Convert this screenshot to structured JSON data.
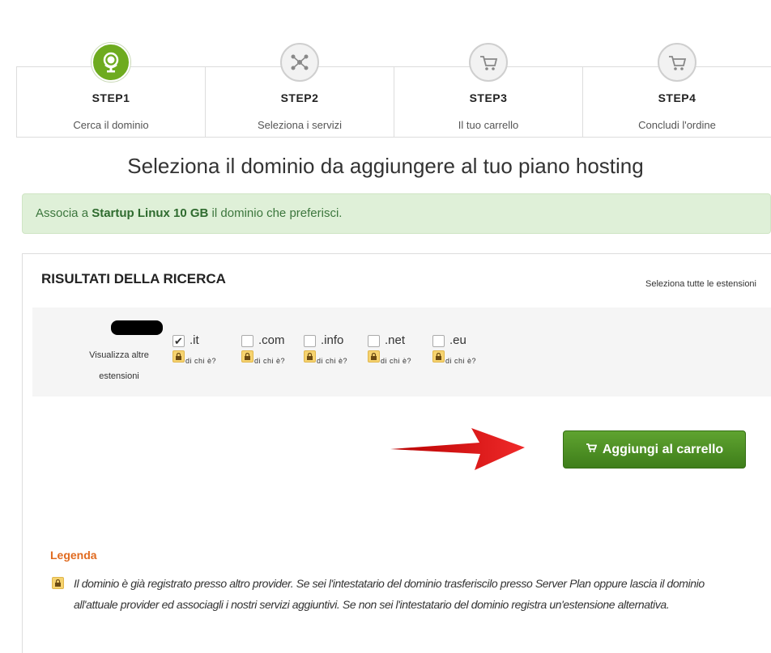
{
  "steps": [
    {
      "title": "STEP1",
      "subtitle": "Cerca il dominio",
      "icon": "globe-icon",
      "active": true
    },
    {
      "title": "STEP2",
      "subtitle": "Seleziona i servizi",
      "icon": "network-icon",
      "active": false
    },
    {
      "title": "STEP3",
      "subtitle": "Il tuo carrello",
      "icon": "cart-icon",
      "active": false
    },
    {
      "title": "STEP4",
      "subtitle": "Concludi l'ordine",
      "icon": "cart-icon",
      "active": false
    }
  ],
  "page_title": "Seleziona il dominio da aggiungere al tuo piano hosting",
  "alert": {
    "prefix": "Associa a ",
    "product": "Startup Linux 10 GB",
    "suffix": " il dominio che preferisci."
  },
  "results": {
    "title": "RISULTATI DELLA RICERCA",
    "select_all": "Seleziona tutte le estensioni",
    "more_label_1": "Visualizza altre",
    "more_label_2": "estensioni",
    "extensions": [
      {
        "name": ".it",
        "checked": true,
        "whois": "di chi è?"
      },
      {
        "name": ".com",
        "checked": false,
        "whois": "di chi è?"
      },
      {
        "name": ".info",
        "checked": false,
        "whois": "di chi è?"
      },
      {
        "name": ".net",
        "checked": false,
        "whois": "di chi è?"
      },
      {
        "name": ".eu",
        "checked": false,
        "whois": "di chi è?"
      }
    ]
  },
  "cart_button": {
    "label": "Aggiungi al carrello",
    "icon": "cart-icon"
  },
  "legend": {
    "title": "Legenda",
    "text": "Il dominio è già registrato presso altro provider. Se sei l'intestatario del dominio trasferiscilo presso Server Plan oppure lascia il dominio all'attuale provider ed associagli i nostri servizi aggiuntivi. Se non sei l'intestatario del dominio registra un'estensione alternativa."
  },
  "colors": {
    "active_step": "#6eab1f",
    "button": "#4c8f22",
    "alert_bg": "#dff0d8",
    "legend_title": "#e06a1f",
    "arrow": "#e31b1b"
  }
}
